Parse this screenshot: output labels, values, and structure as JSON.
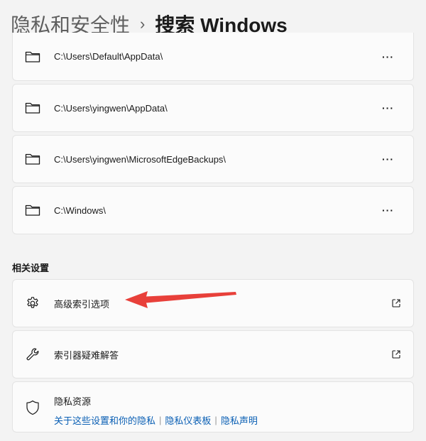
{
  "breadcrumb": {
    "parent": "隐私和安全性",
    "separator": "›",
    "current": "搜索 Windows"
  },
  "excluded_folders": [
    {
      "path": "C:\\Users\\Default\\AppData\\",
      "more": "···"
    },
    {
      "path": "C:\\Users\\yingwen\\AppData\\",
      "more": "···"
    },
    {
      "path": "C:\\Users\\yingwen\\MicrosoftEdgeBackups\\",
      "more": "···"
    },
    {
      "path": "C:\\Windows\\",
      "more": "···"
    }
  ],
  "related_settings": {
    "title": "相关设置",
    "advanced_indexing": {
      "label": "高级索引选项",
      "icon": "gear-icon"
    },
    "indexer_troubleshooter": {
      "label": "索引器疑难解答",
      "icon": "wrench-icon"
    },
    "privacy_resources": {
      "title": "隐私资源",
      "icon": "shield-icon",
      "links": [
        "关于这些设置和你的隐私",
        "隐私仪表板",
        "隐私声明"
      ],
      "link_separator": "|"
    }
  },
  "colors": {
    "link": "#0a5fb4",
    "annotation_arrow": "#e8403a"
  }
}
